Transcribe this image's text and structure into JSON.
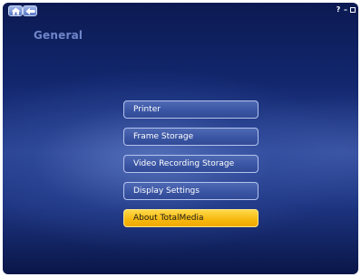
{
  "screen": {
    "title": "General"
  },
  "menu": {
    "items": [
      {
        "label": "Printer",
        "focused": false
      },
      {
        "label": "Frame Storage",
        "focused": false
      },
      {
        "label": "Video Recording Storage",
        "focused": false
      },
      {
        "label": "Display Settings",
        "focused": false
      },
      {
        "label": "About TotalMedia",
        "focused": true
      }
    ]
  },
  "window_controls": {
    "help_glyph": "?",
    "minimize_glyph": "–"
  },
  "icons": {
    "home": "home-icon",
    "back": "back-arrow-icon",
    "help": "help-icon",
    "minimize": "minimize-icon",
    "close": "close-icon"
  },
  "colors": {
    "background_top": "#0c1a52",
    "background_mid": "#2a4392",
    "menu_item_fill": "#3a55a3",
    "menu_item_border": "#b3c3ee",
    "focus_fill": "#f6b80d",
    "title_text": "#6f86c9"
  }
}
